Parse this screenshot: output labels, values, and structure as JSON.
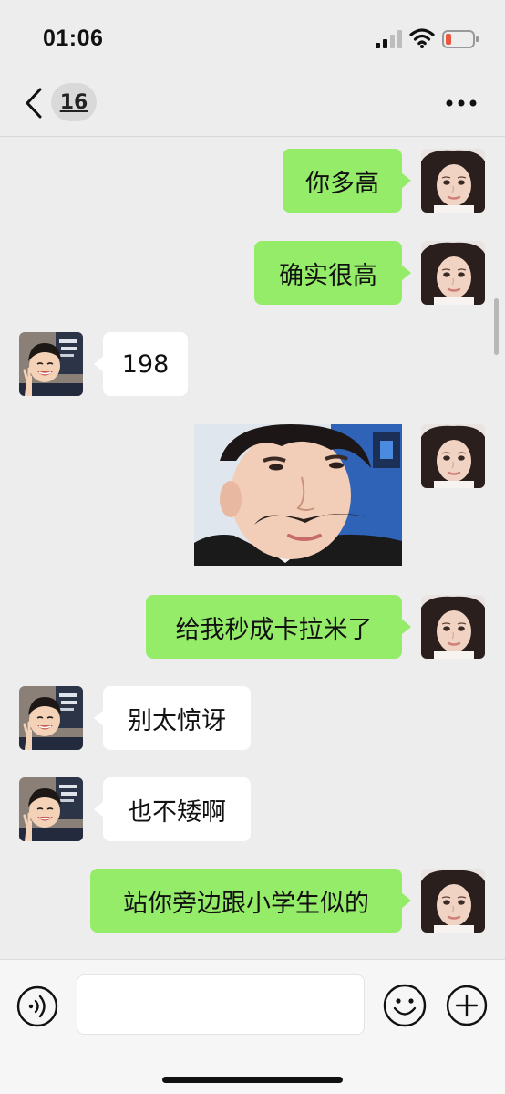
{
  "status_bar": {
    "time": "01:06"
  },
  "nav": {
    "unread_count": "16"
  },
  "messages": [
    {
      "sender": "me",
      "type": "text",
      "text": "你多高"
    },
    {
      "sender": "me",
      "type": "text",
      "text": "确实很高"
    },
    {
      "sender": "them",
      "type": "text",
      "text": "198"
    },
    {
      "sender": "me",
      "type": "image",
      "image": "photo-of-boy-with-drawn-mustache"
    },
    {
      "sender": "me",
      "type": "text",
      "text": "给我秒成卡拉米了"
    },
    {
      "sender": "them",
      "type": "text",
      "text": "别太惊讶"
    },
    {
      "sender": "them",
      "type": "text",
      "text": "也不矮啊"
    },
    {
      "sender": "me",
      "type": "text",
      "text": "站你旁边跟小学生似的"
    }
  ],
  "input": {
    "value": "",
    "placeholder": ""
  },
  "colors": {
    "background": "#ededed",
    "my_bubble": "#95ec69",
    "their_bubble": "#ffffff",
    "input_bar": "#f6f6f6"
  }
}
